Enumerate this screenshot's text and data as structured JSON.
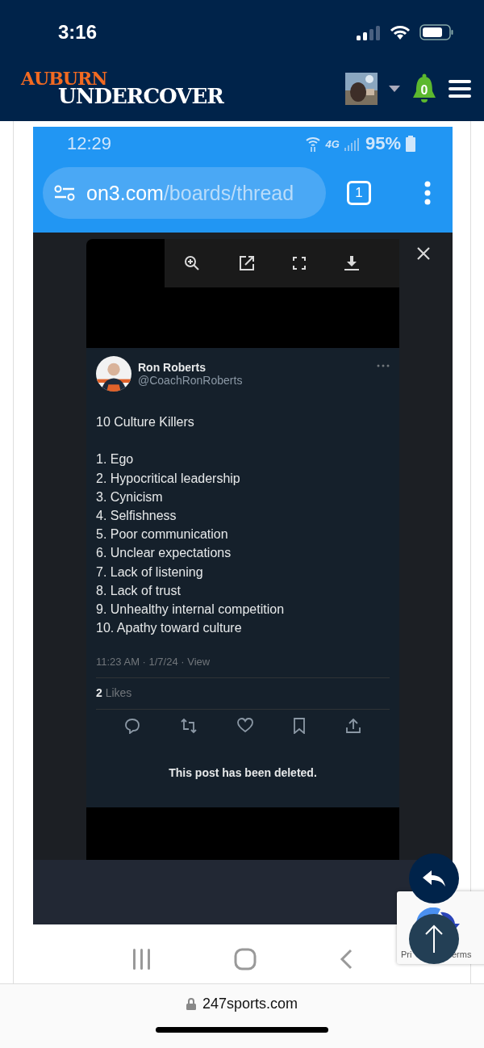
{
  "ios_status": {
    "time": "3:16"
  },
  "site_header": {
    "logo_top": "AUBURN",
    "logo_bottom": "UNDERCOVER",
    "notifications": "0"
  },
  "embedded_screenshot": {
    "status": {
      "time": "12:29",
      "network": "4G",
      "battery": "95%"
    },
    "address_bar": {
      "host": "on3.com",
      "path": "/boards/thread",
      "tab_count": "1"
    },
    "post": {
      "name": "Ron Roberts",
      "handle": "@CoachRonRoberts",
      "title": "10 Culture Killers",
      "items": [
        "1. Ego",
        "2. Hypocritical leadership",
        "3. Cynicism",
        "4. Selfishness",
        "5. Poor communication",
        "6. Unclear expectations",
        "7. Lack of listening",
        "8. Lack of trust",
        "9. Unhealthy internal competition",
        "10. Apathy toward culture"
      ],
      "timestamp": "11:23 AM · 1/7/24 · View",
      "likes_count": "2",
      "likes_label": "Likes",
      "notice": "This post has been deleted."
    }
  },
  "recaptcha": {
    "left_text": "Pri",
    "right_text": "erms"
  },
  "browser_bar": {
    "domain": "247sports.com"
  }
}
